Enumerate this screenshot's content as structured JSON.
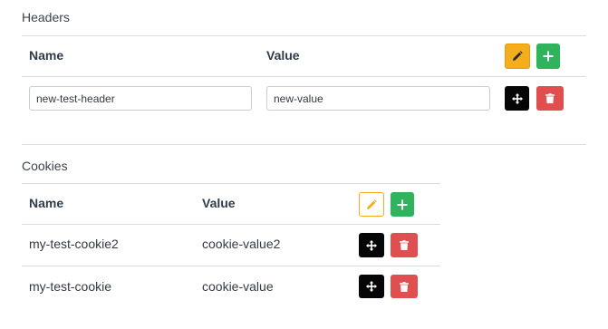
{
  "headers": {
    "title": "Headers",
    "columns": {
      "name": "Name",
      "value": "Value"
    },
    "rows": [
      {
        "name": "new-test-header",
        "value": "new-value"
      }
    ],
    "actions": {
      "edit_icon": "pencil-icon",
      "add_icon": "plus-icon",
      "move_icon": "move-icon",
      "delete_icon": "trash-icon"
    }
  },
  "cookies": {
    "title": "Cookies",
    "columns": {
      "name": "Name",
      "value": "Value"
    },
    "rows": [
      {
        "name": "my-test-cookie2",
        "value": "cookie-value2"
      },
      {
        "name": "my-test-cookie",
        "value": "cookie-value"
      }
    ],
    "actions": {
      "edit_icon": "pencil-icon",
      "add_icon": "plus-icon",
      "move_icon": "move-icon",
      "delete_icon": "trash-icon"
    }
  },
  "colors": {
    "edit": "#f4ad1c",
    "add": "#30b35d",
    "move": "#060606",
    "delete": "#df4f4f"
  }
}
